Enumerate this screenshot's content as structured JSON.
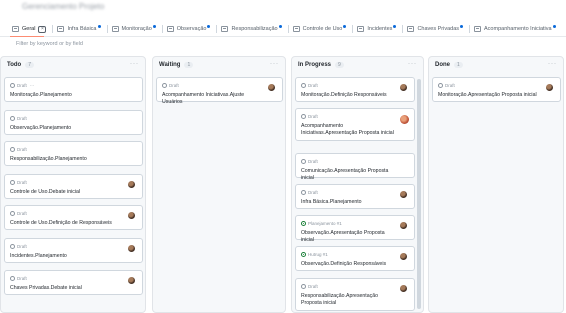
{
  "header": {
    "title": "Gerenciamento Projeto"
  },
  "tabs": [
    {
      "label": "Geral",
      "active": true,
      "closable": true,
      "dot": false
    },
    {
      "label": "Infra Básica",
      "dot": true
    },
    {
      "label": "Monitoração",
      "dot": true
    },
    {
      "label": "Observação",
      "dot": true
    },
    {
      "label": "Responsabilização",
      "dot": true
    },
    {
      "label": "Controle de Uso",
      "dot": true
    },
    {
      "label": "Incidentes",
      "dot": true
    },
    {
      "label": "Chaves Privadas",
      "dot": true
    },
    {
      "label": "Acompanhamento Iniciativa",
      "dot": true
    }
  ],
  "filter": {
    "placeholder": "Filter by keyword or by field"
  },
  "columns": [
    {
      "name": "Todo",
      "count": "7",
      "cards": [
        {
          "status": "Draft",
          "menu": "···",
          "title": "Monitoração.Planejamento",
          "avatar": false
        },
        {
          "status": "Draft",
          "title": "Observação.Planejamento",
          "avatar": false
        },
        {
          "status": "Draft",
          "title": "Responsabilização.Planejamento",
          "avatar": false
        },
        {
          "status": "Draft",
          "title": "Controle de Uso.Debate inicial",
          "avatar": true
        },
        {
          "status": "Draft",
          "title": "Controle de Uso.Definição de Responsáveis",
          "avatar": true
        },
        {
          "status": "Draft",
          "title": "Incidentes.Planejamento",
          "avatar": true
        },
        {
          "status": "Draft",
          "title": "Chaves Privadas.Debate inicial",
          "avatar": true
        }
      ]
    },
    {
      "name": "Waiting",
      "count": "1",
      "cards": [
        {
          "status": "Draft",
          "title": "Acompanhamento Iniciativas.Ajuste Usuários",
          "avatar": true
        }
      ]
    },
    {
      "name": "In Progress",
      "count": "9",
      "cards": [
        {
          "status": "Draft",
          "title": "Monitoração.Definição Responsáveis",
          "avatar": true
        },
        {
          "status": "Draft",
          "title": "Acompanhamento Iniciativas.Apresentação Proposta inicial",
          "avatar": true,
          "multi": true
        },
        {
          "status": "Draft",
          "title": "Comunicação.Apresentação Proposta inicial",
          "avatar": false
        },
        {
          "status": "Draft",
          "title": "Infra Básica.Planejamento",
          "avatar": true
        },
        {
          "status": "Planejamento #1",
          "green": true,
          "title": "Observação.Apresentação Proposta inicial",
          "avatar": true
        },
        {
          "status": "Hutrug #1",
          "green": true,
          "title": "Observação.Definição Responsáveis",
          "avatar": true
        },
        {
          "status": "Draft",
          "title": "Responsabilização.Apresentação Proposta inicial",
          "avatar": true
        }
      ]
    },
    {
      "name": "Done",
      "count": "1",
      "cards": [
        {
          "status": "Draft",
          "title": "Monitoração.Apresentação Proposta inicial",
          "avatar": true
        }
      ]
    }
  ],
  "col_menu": "···"
}
